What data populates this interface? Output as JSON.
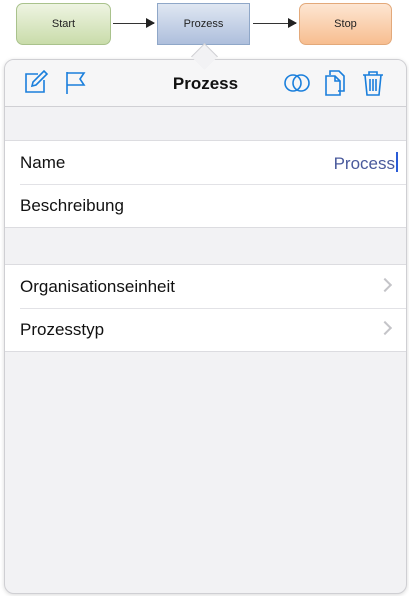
{
  "diagram": {
    "nodes": [
      {
        "label": "Start"
      },
      {
        "label": "Prozess"
      },
      {
        "label": "Stop"
      }
    ]
  },
  "popover": {
    "title": "Prozess",
    "toolbar_icons": [
      "edit-icon",
      "flag-icon",
      "link-icon",
      "copy-icon",
      "trash-icon"
    ],
    "accent_color": "#1a7fdc",
    "section_1": {
      "name_label": "Name",
      "name_value": "Process",
      "description_label": "Beschreibung"
    },
    "section_2": {
      "org_unit_label": "Organisationseinheit",
      "process_type_label": "Prozesstyp"
    }
  }
}
